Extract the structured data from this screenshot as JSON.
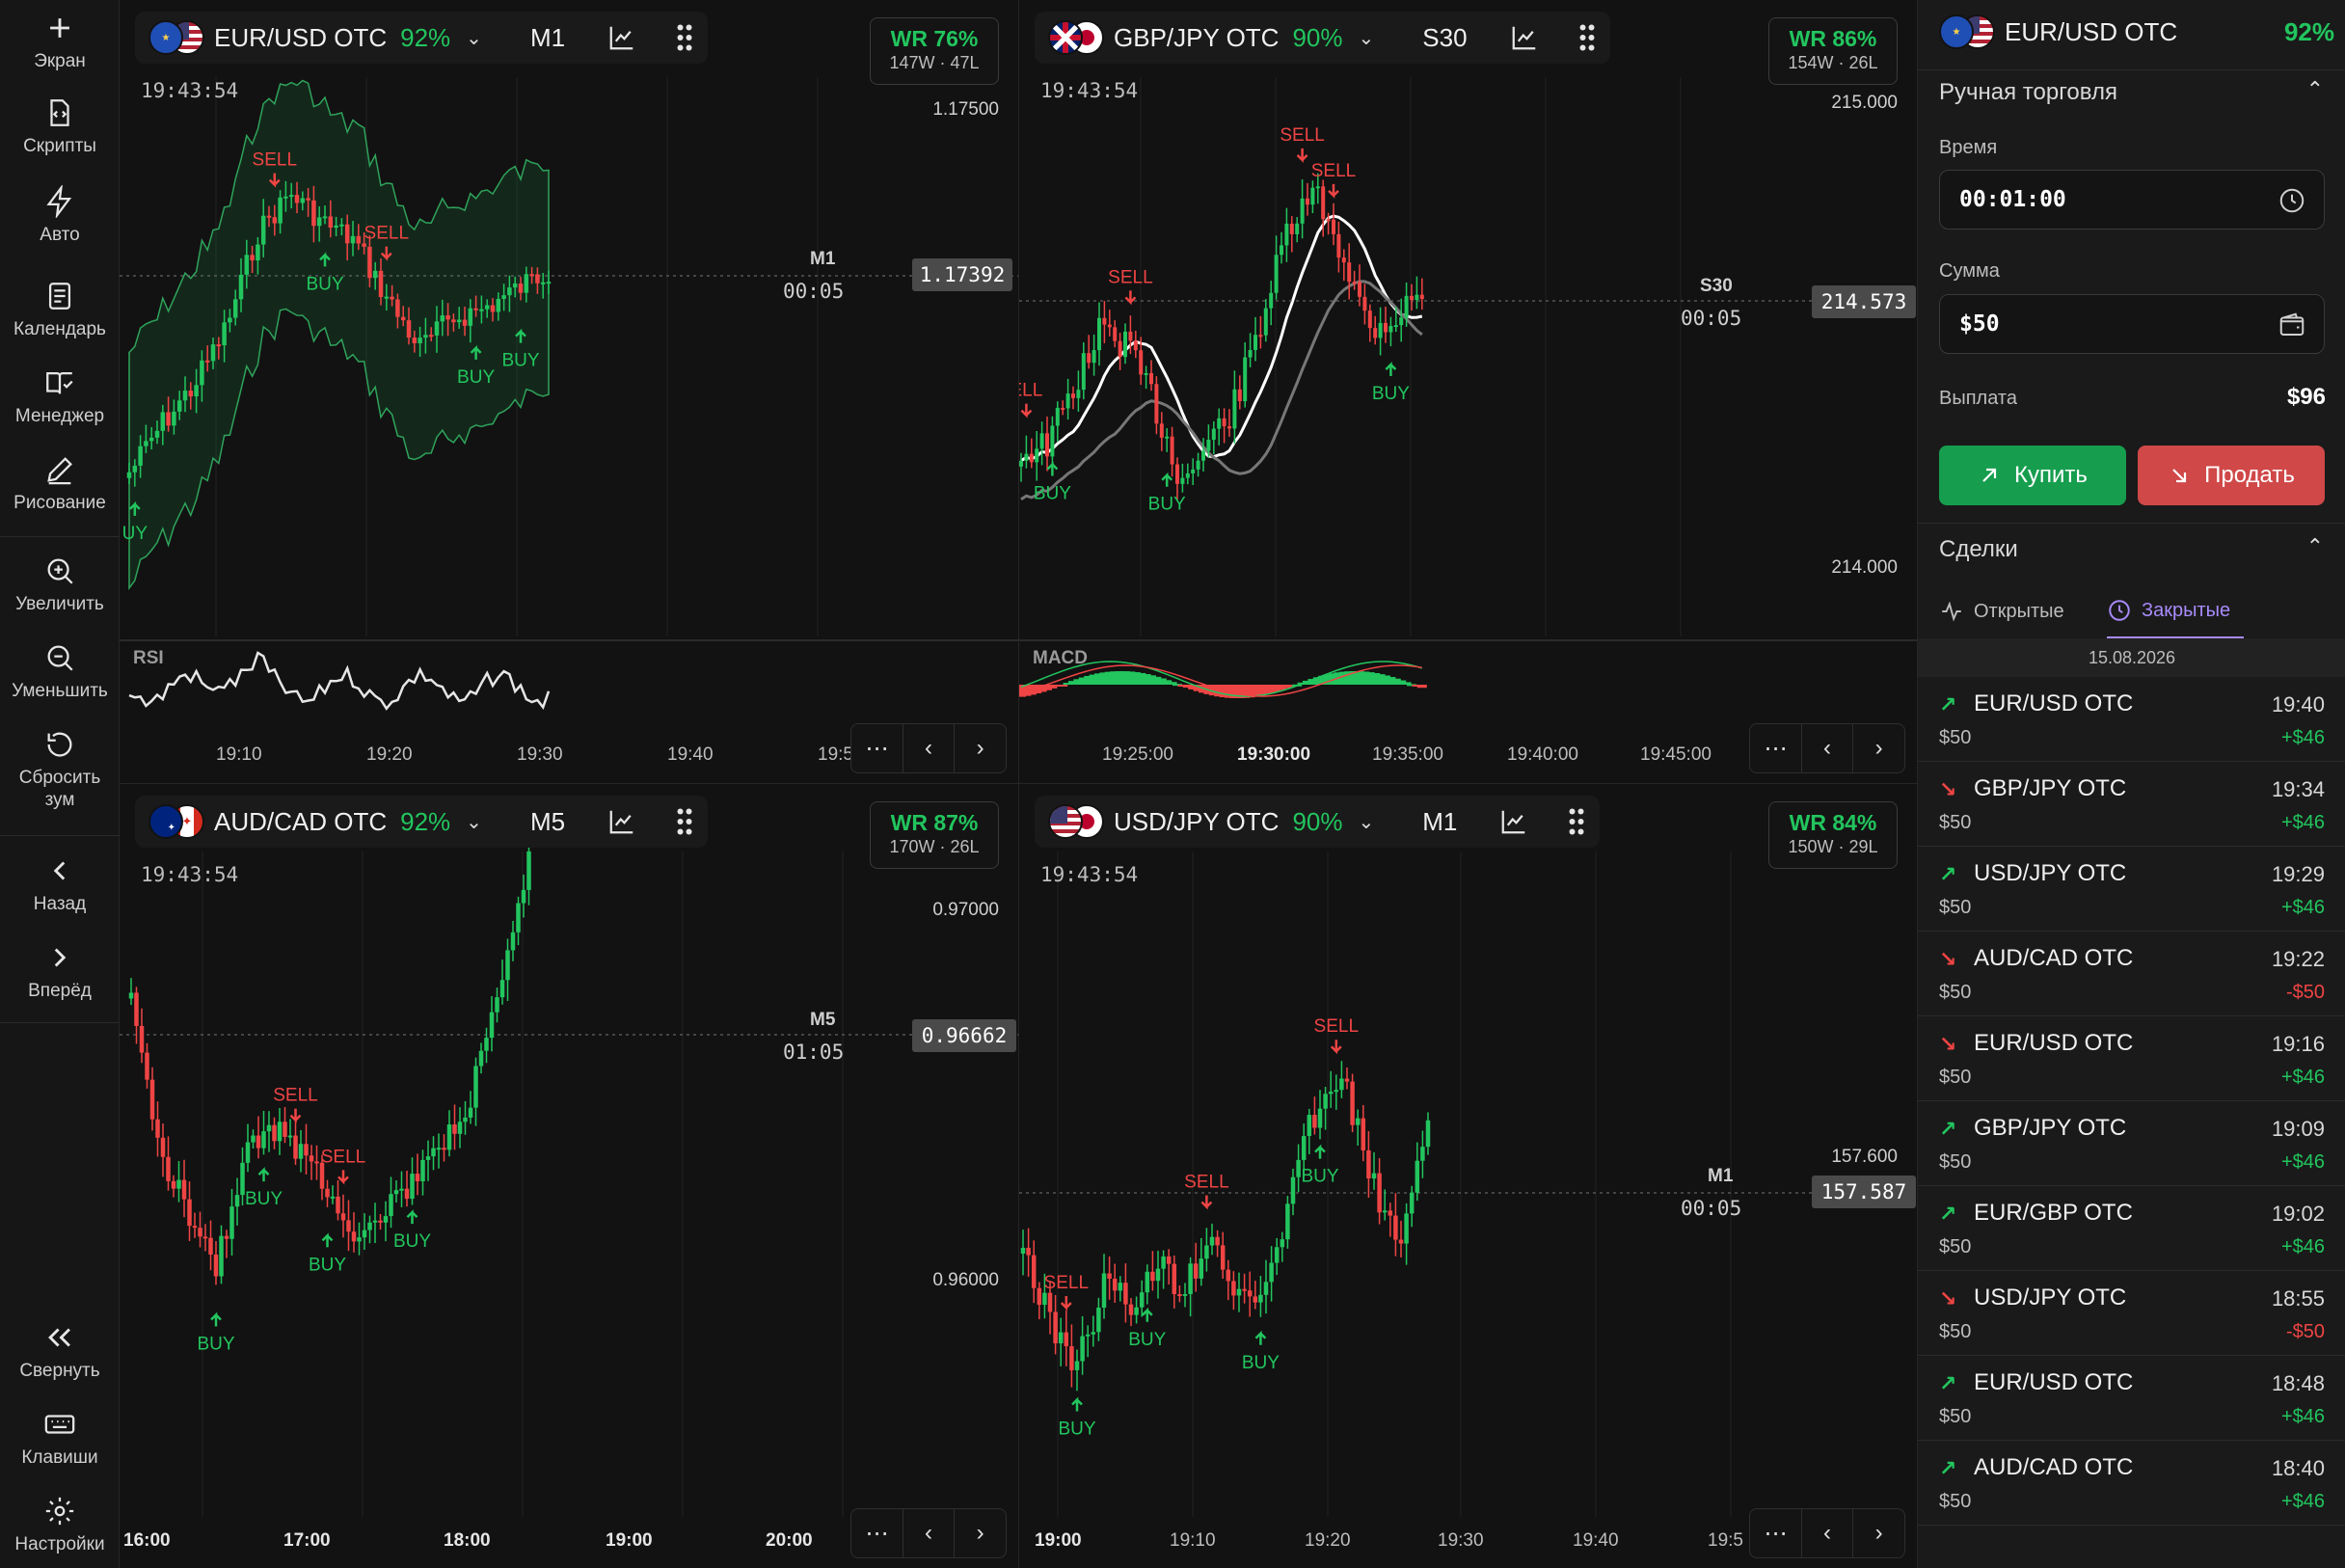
{
  "sidebar": {
    "screen": "Экран",
    "scripts": "Скрипты",
    "auto": "Авто",
    "calendar": "Календарь",
    "manager": "Менеджер",
    "drawing": "Рисование",
    "zoom_in": "Увеличить",
    "zoom_out": "Уменьшить",
    "reset_zoom": "Сбросить\nзум",
    "back": "Назад",
    "forward": "Вперёд",
    "collapse": "Свернуть",
    "keys": "Клавиши",
    "settings": "Настройки"
  },
  "charts": [
    {
      "pair": "EUR/USD OTC",
      "payout": "92%",
      "timeframe": "M1",
      "clock": "19:43:54",
      "wr": "WR 76%",
      "record": "147W · 47L",
      "price_label": "1.17392",
      "tf_label": "M1",
      "countdown": "00:05",
      "y_labels": [
        "1.17500"
      ],
      "indicator": "RSI",
      "x_labels": [
        "19:10",
        "19:20",
        "19:30",
        "19:40",
        "19:5"
      ],
      "signals": [
        {
          "t": "SELL",
          "c": 26
        },
        {
          "t": "SELL",
          "c": 46
        },
        {
          "t": "BUY",
          "c": 35
        },
        {
          "t": "BUY",
          "c": 62
        },
        {
          "t": "BUY",
          "c": 70
        },
        {
          "t": "UY",
          "c": 1
        }
      ],
      "colors": {
        "up": "#22c55e",
        "down": "#ef4444"
      }
    },
    {
      "pair": "GBP/JPY OTC",
      "payout": "90%",
      "timeframe": "S30",
      "clock": "19:43:54",
      "wr": "WR 86%",
      "record": "154W · 26L",
      "price_label": "214.573",
      "tf_label": "S30",
      "countdown": "00:05",
      "y_labels": [
        "215.000",
        "214.000"
      ],
      "indicator": "MACD",
      "x_labels": [
        "19:25:00",
        "19:30:00",
        "19:35:00",
        "19:40:00",
        "19:45:00"
      ],
      "bold_x": "19:30:00",
      "signals": [
        {
          "t": "SELL",
          "c": 21
        },
        {
          "t": "SELL",
          "c": 54
        },
        {
          "t": "SELL",
          "c": 60
        },
        {
          "t": "ELL",
          "c": 1
        },
        {
          "t": "BUY",
          "c": 6
        },
        {
          "t": "BUY",
          "c": 28
        },
        {
          "t": "BUY",
          "c": 71
        }
      ]
    },
    {
      "pair": "AUD/CAD OTC",
      "payout": "92%",
      "timeframe": "M5",
      "clock": "19:43:54",
      "wr": "WR 87%",
      "record": "170W · 26L",
      "price_label": "0.96662",
      "tf_label": "M5",
      "countdown": "01:05",
      "y_labels": [
        "0.97000",
        "0.96000"
      ],
      "x_labels": [
        "16:00",
        "17:00",
        "18:00",
        "19:00",
        "20:00"
      ],
      "signals": [
        {
          "t": "SELL",
          "c": 31
        },
        {
          "t": "SELL",
          "c": 40
        },
        {
          "t": "BUY",
          "c": 16
        },
        {
          "t": "BUY",
          "c": 25
        },
        {
          "t": "BUY",
          "c": 37
        },
        {
          "t": "BUY",
          "c": 53
        }
      ]
    },
    {
      "pair": "USD/JPY OTC",
      "payout": "90%",
      "timeframe": "M1",
      "clock": "19:43:54",
      "wr": "WR 84%",
      "record": "150W · 29L",
      "price_label": "157.587",
      "tf_label": "M1",
      "countdown": "00:05",
      "y_labels": [
        "157.600"
      ],
      "x_labels": [
        "19:00",
        "19:10",
        "19:20",
        "19:30",
        "19:40",
        "19:5"
      ],
      "bold_x": "19:00",
      "signals": [
        {
          "t": "SELL",
          "c": 8
        },
        {
          "t": "SELL",
          "c": 34
        },
        {
          "t": "SELL",
          "c": 58
        },
        {
          "t": "BUY",
          "c": 10
        },
        {
          "t": "BUY",
          "c": 23
        },
        {
          "t": "BUY",
          "c": 44
        },
        {
          "t": "BUY",
          "c": 55
        }
      ]
    }
  ],
  "trade": {
    "pair": "EUR/USD OTC",
    "payout": "92%",
    "section": "Ручная торговля",
    "time_label": "Время",
    "time_value": "00:01:00",
    "amount_label": "Сумма",
    "amount_value": "$50",
    "payout_label": "Выплата",
    "payout_value": "$96",
    "buy": "Купить",
    "sell": "Продать",
    "deals_title": "Сделки",
    "tab_open": "Открытые",
    "tab_closed": "Закрытые",
    "date": "15.08.2026",
    "deals": [
      {
        "pair": "EUR/USD OTC",
        "dir": "up",
        "amount": "$50",
        "time": "19:40",
        "pl": "+$46"
      },
      {
        "pair": "GBP/JPY OTC",
        "dir": "down",
        "amount": "$50",
        "time": "19:34",
        "pl": "+$46"
      },
      {
        "pair": "USD/JPY OTC",
        "dir": "up",
        "amount": "$50",
        "time": "19:29",
        "pl": "+$46"
      },
      {
        "pair": "AUD/CAD OTC",
        "dir": "down",
        "amount": "$50",
        "time": "19:22",
        "pl": "-$50"
      },
      {
        "pair": "EUR/USD OTC",
        "dir": "down",
        "amount": "$50",
        "time": "19:16",
        "pl": "+$46"
      },
      {
        "pair": "GBP/JPY OTC",
        "dir": "up",
        "amount": "$50",
        "time": "19:09",
        "pl": "+$46"
      },
      {
        "pair": "EUR/GBP OTC",
        "dir": "up",
        "amount": "$50",
        "time": "19:02",
        "pl": "+$46"
      },
      {
        "pair": "USD/JPY OTC",
        "dir": "down",
        "amount": "$50",
        "time": "18:55",
        "pl": "-$50"
      },
      {
        "pair": "EUR/USD OTC",
        "dir": "up",
        "amount": "$50",
        "time": "18:48",
        "pl": "+$46"
      },
      {
        "pair": "AUD/CAD OTC",
        "dir": "up",
        "amount": "$50",
        "time": "18:40",
        "pl": "+$46"
      }
    ]
  }
}
